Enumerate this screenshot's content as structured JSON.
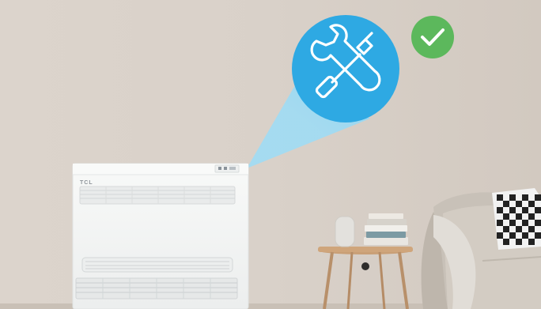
{
  "scene": {
    "brand_text": "TCL",
    "colors": {
      "wall": "#d8d0c8",
      "floor": "#cfc7be",
      "badge_blue": "#2ea9e3",
      "beam": "#8fd3f2",
      "check_green": "#5cb85c",
      "unit_white": "#f4f5f4"
    },
    "icons": {
      "service_badge": "wrench-screwdriver-icon",
      "status": "checkmark-icon"
    }
  }
}
